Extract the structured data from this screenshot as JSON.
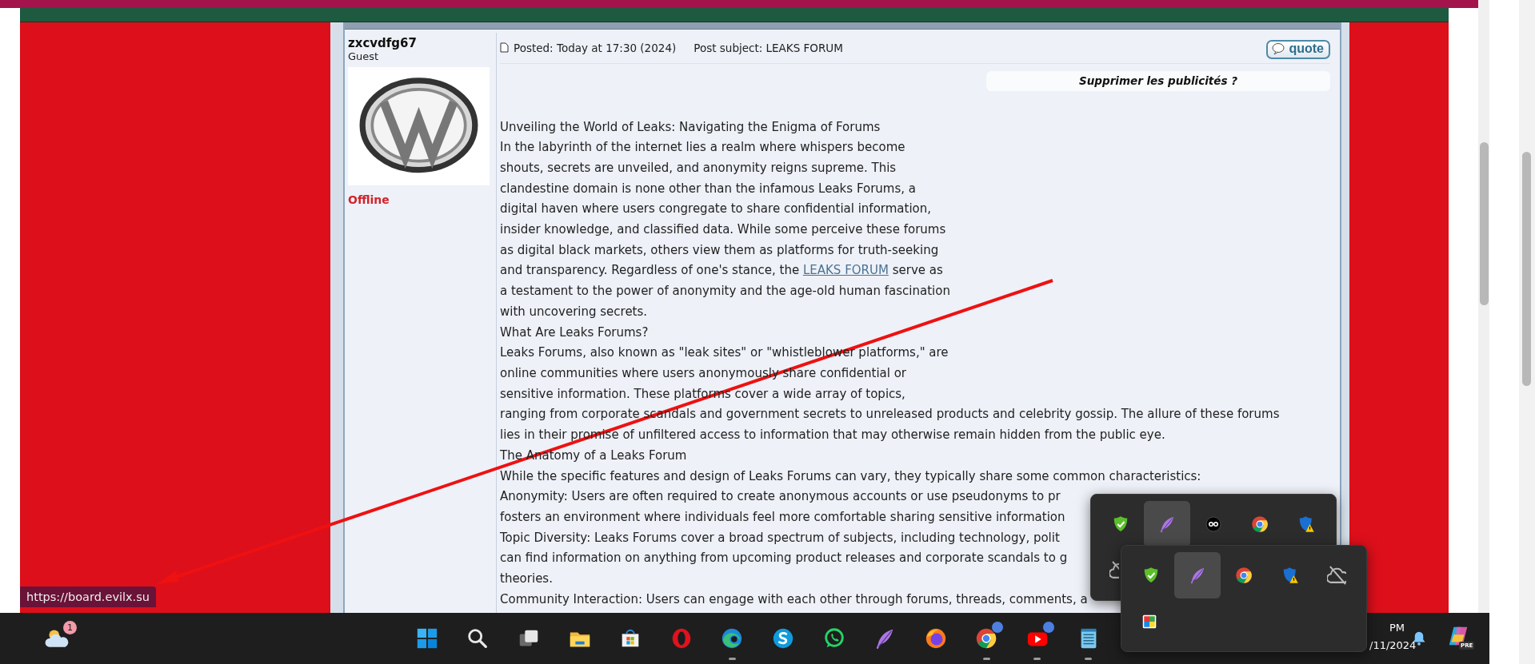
{
  "browser": {
    "status_url": "https://board.evilx.su"
  },
  "post": {
    "author": "zxcvdfg67",
    "rank": "Guest",
    "status": "Offline",
    "posted": "Posted: Today at 17:30 (2024)",
    "subject": "Post subject: LEAKS FORUM",
    "quote_button": "quote",
    "ad_notice": "Supprimer les publicités ?",
    "lines": [
      {
        "kind": "text",
        "text": "Unveiling the World of Leaks: Navigating the Enigma of Forums"
      },
      {
        "kind": "text",
        "text": "In the labyrinth of the internet lies a realm where whispers become"
      },
      {
        "kind": "text",
        "text": "shouts, secrets are unveiled, and anonymity reigns supreme. This"
      },
      {
        "kind": "text",
        "text": "clandestine domain is none other than the infamous Leaks Forums, a"
      },
      {
        "kind": "text",
        "text": "digital haven where users congregate to share confidential information,"
      },
      {
        "kind": "text",
        "text": "insider knowledge, and classified data. While some perceive these forums"
      },
      {
        "kind": "text",
        "text": "as digital black markets, others view them as platforms for truth-seeking"
      },
      {
        "kind": "link",
        "before": "and transparency. Regardless of one's stance, the",
        "link": "LEAKS FORUM",
        "after": "serve as"
      },
      {
        "kind": "text",
        "text": "a testament to the power of anonymity and the age-old human fascination"
      },
      {
        "kind": "text",
        "text": "with uncovering secrets."
      },
      {
        "kind": "text",
        "text": "What Are Leaks Forums?"
      },
      {
        "kind": "text",
        "text": "Leaks Forums, also known as \"leak sites\" or \"whistleblower platforms,\" are"
      },
      {
        "kind": "text",
        "text": "online communities where users anonymously share confidential or"
      },
      {
        "kind": "text",
        "text": "sensitive information. These platforms cover a wide array of topics,"
      },
      {
        "kind": "text",
        "text": "ranging from corporate scandals and government secrets to unreleased products and celebrity gossip. The allure of these forums"
      },
      {
        "kind": "text",
        "text": "lies in their promise of unfiltered access to information that may otherwise remain hidden from the public eye."
      },
      {
        "kind": "text",
        "text": "The Anatomy of a Leaks Forum"
      },
      {
        "kind": "text",
        "text": "While the specific features and design of Leaks Forums can vary, they typically share some common characteristics:"
      },
      {
        "kind": "text",
        "text": "Anonymity: Users are often required to create anonymous accounts or use pseudonyms to pr"
      },
      {
        "kind": "text",
        "text": "fosters an environment where individuals feel more comfortable sharing sensitive information"
      },
      {
        "kind": "text",
        "text": "Topic Diversity: Leaks Forums cover a broad spectrum of subjects, including technology, polit"
      },
      {
        "kind": "text",
        "text": "can find information on anything from upcoming product releases and corporate scandals to g"
      },
      {
        "kind": "text",
        "text": "theories."
      },
      {
        "kind": "text",
        "text": "Community Interaction: Users can engage with each other through forums, threads, comments, a"
      }
    ]
  },
  "taskbar": {
    "weather_badge": "1",
    "apps": [
      {
        "running": false
      },
      {
        "running": false
      },
      {
        "running": false
      },
      {
        "running": false
      },
      {
        "running": false
      },
      {
        "running": false
      },
      {
        "running": true
      },
      {
        "running": false
      },
      {
        "running": false
      },
      {
        "running": false
      },
      {
        "running": false
      },
      {
        "running": true
      },
      {
        "running": true
      },
      {
        "running": true
      }
    ],
    "clock": {
      "time": "PM",
      "date": "/11/2024"
    },
    "copilot_badge": "PRE"
  },
  "tray_overflow": [
    {
      "items": [
        {
          "highlighted": false
        },
        {
          "highlighted": true
        },
        {
          "highlighted": false
        },
        {
          "highlighted": false
        },
        {
          "highlighted": false
        },
        {
          "highlighted": false
        }
      ]
    },
    {
      "items": [
        {
          "highlighted": false
        },
        {
          "highlighted": true
        },
        {
          "highlighted": false
        },
        {
          "highlighted": false
        },
        {
          "highlighted": false
        },
        {
          "highlighted": false
        }
      ]
    }
  ]
}
